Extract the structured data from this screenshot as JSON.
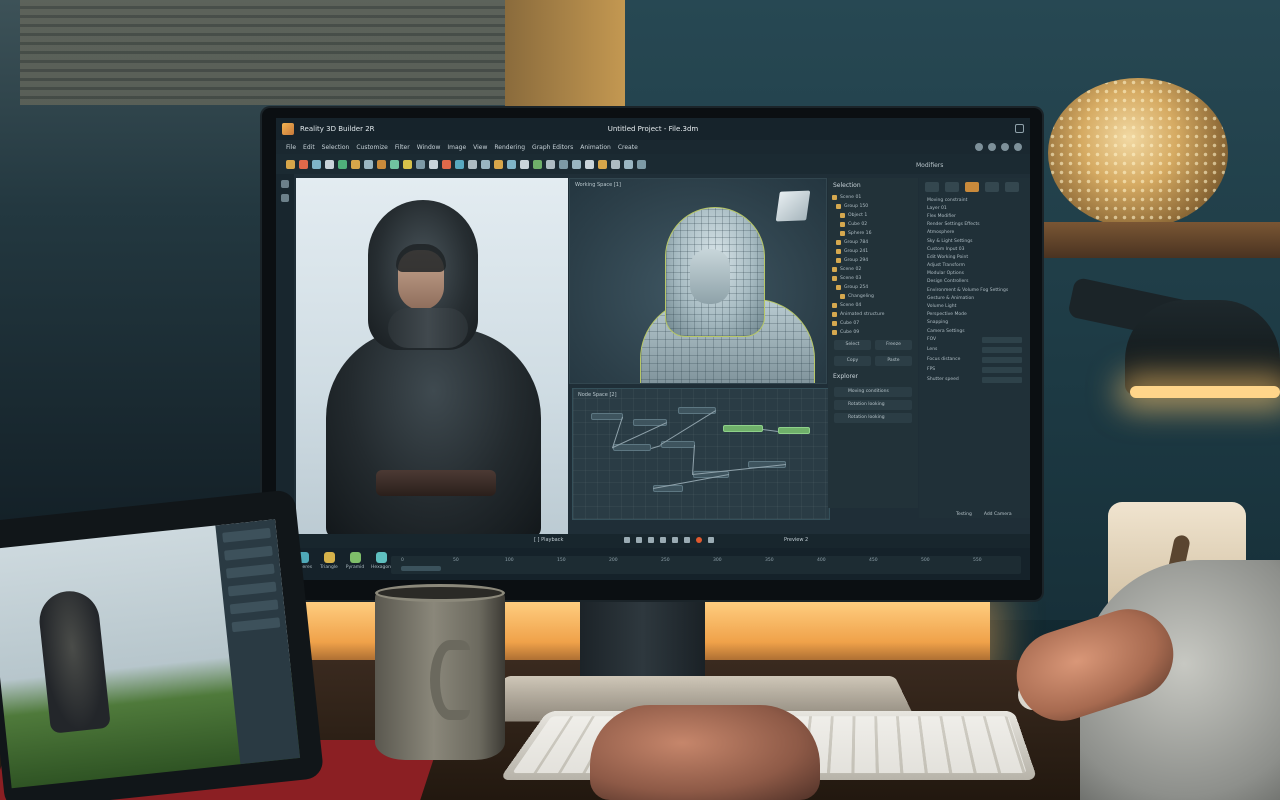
{
  "app": {
    "name": "Reality 3D Builder 2R",
    "project_title": "Untitled Project - File.3dm"
  },
  "menu": [
    "File",
    "Edit",
    "Selection",
    "Customize",
    "Filter",
    "Window",
    "Image",
    "View",
    "Rendering",
    "Graph Editors",
    "Animation",
    "Create"
  ],
  "panels": {
    "working_space": "Working Space [1]",
    "node_space": "Node Space [2]",
    "selection": "Selection",
    "explorer": "Explorer",
    "modifiers": "Modifiers",
    "playback": "[ ] Playback",
    "preview": "Preview 2"
  },
  "selection_tree": [
    "Scene 01",
    "Group 150",
    "Object 1",
    "Cube 02",
    "Sphere 16",
    "Group 784",
    "Group 241",
    "Group 294",
    "Scene 02",
    "Scene 03",
    "Group 254",
    "Changeling",
    "Scene 04",
    "Animated structure",
    "Cube 07",
    "Cube 09"
  ],
  "selection_buttons": [
    "Select",
    "Freeze",
    "Copy",
    "Paste"
  ],
  "explorer_items": [
    "Moving conditions",
    "Rotation looking",
    "Rotation looking"
  ],
  "modifiers": {
    "header": "Moving constraint",
    "items": [
      "Layer 01",
      "Flex Modifier",
      "Render Settings Effects",
      "Atmosphere",
      "Sky & Light Settings",
      "Custom Input 03",
      "Edit Working Point",
      "Adjust Transform",
      "Modular Options",
      "Design Controllers",
      "Environment & Volume Fog Settings",
      "Gesture & Animation",
      "Volume Light"
    ],
    "section": "Perspective Mode",
    "sub": "Snapping",
    "camera_settings": "Camera Settings",
    "props": [
      "FOV",
      "Lens",
      "Focus distance",
      "FPS",
      "Shutter speed"
    ],
    "footer_buttons": [
      "Testing",
      "Add Camera"
    ]
  },
  "dock": [
    "Spheres",
    "Triangle",
    "Pyramid",
    "Hexagon"
  ],
  "timeline_ticks": [
    "0",
    "50",
    "100",
    "150",
    "200",
    "250",
    "300",
    "350",
    "400",
    "450",
    "500",
    "550"
  ],
  "colors": {
    "accent": "#c98a3b",
    "node_active": "#6fb06a",
    "mesh_outline": "#b7c766"
  }
}
